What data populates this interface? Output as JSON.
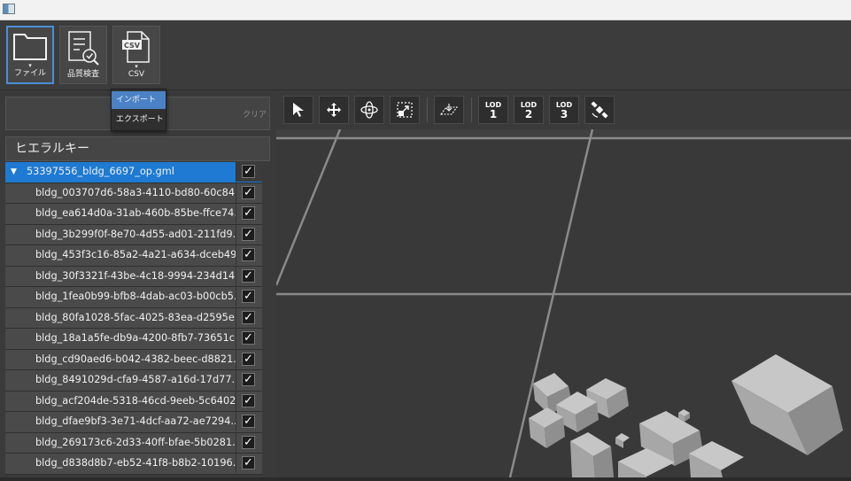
{
  "ribbon": {
    "file_label": "ファイル",
    "quality_label": "品質検査",
    "csv_label": "CSV",
    "csv_badge": "CSV",
    "dropdown_marker": "▾"
  },
  "csv_menu": {
    "items": [
      "インポート",
      "エクスポート"
    ]
  },
  "search": {
    "value": "",
    "clear_label": "クリア"
  },
  "hierarchy": {
    "title": "ヒエラルキー",
    "root": {
      "label": "53397556_bldg_6697_op.gml",
      "expand": "▼",
      "checked": "✓"
    },
    "items": [
      "bldg_003707d6-58a3-4110-bd80-60c84...",
      "bldg_ea614d0a-31ab-460b-85be-ffce74...",
      "bldg_3b299f0f-8e70-4d55-ad01-211fd9...",
      "bldg_453f3c16-85a2-4a21-a634-dceb49...",
      "bldg_30f3321f-43be-4c18-9994-234d14...",
      "bldg_1fea0b99-bfb8-4dab-ac03-b00cb5...",
      "bldg_80fa1028-5fac-4025-83ea-d2595e...",
      "bldg_18a1a5fe-db9a-4200-8fb7-73651c...",
      "bldg_cd90aed6-b042-4382-beec-d8821...",
      "bldg_8491029d-cfa9-4587-a16d-17d77...",
      "bldg_acf204de-5318-46cd-9eeb-5c6402...",
      "bldg_dfae9bf3-3e71-4dcf-aa72-ae7294...",
      "bldg_269173c6-2d33-40ff-bfae-5b0281...",
      "bldg_d838d8b7-eb52-41f8-b8b2-10196..."
    ],
    "check_mark": "✓"
  },
  "viewport_toolbar": {
    "lod_text": "LOD",
    "lod1": "1",
    "lod2": "2",
    "lod3": "3"
  },
  "colors": {
    "accent": "#1e7ad2",
    "menu_highlight": "#4b82c6",
    "background": "#2b2b2b"
  }
}
